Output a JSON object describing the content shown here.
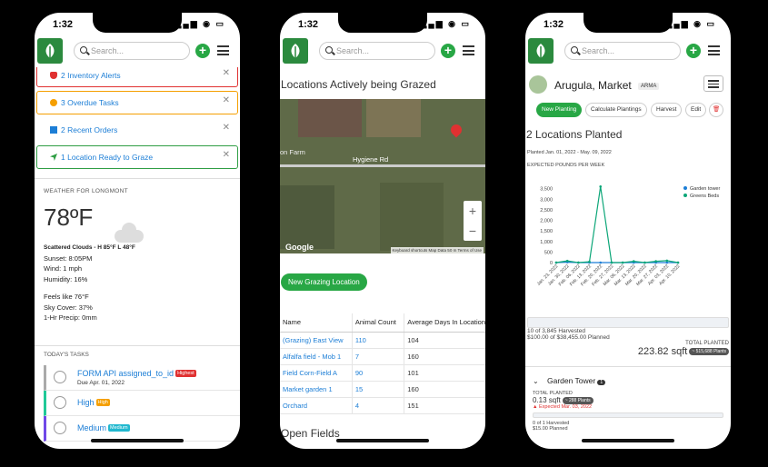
{
  "status": {
    "time": "1:32",
    "icons": "▂▄▆ ◉ ▭"
  },
  "search": {
    "placeholder": "Search..."
  },
  "phone1": {
    "alerts": [
      {
        "label": "2 Inventory Alerts"
      },
      {
        "label": "3 Overdue Tasks"
      },
      {
        "label": "2 Recent Orders"
      },
      {
        "label": "1 Location Ready to Graze"
      }
    ],
    "weather": {
      "label": "WEATHER FOR LONGMONT",
      "temp": "78ºF",
      "summary": "Scattered Clouds - H 85°F L 48°F",
      "sunset": "Sunset: 8:05PM",
      "wind": "Wind: 1 mph",
      "humidity": "Humidity: 16%",
      "feels": "Feels like 76°F",
      "sky": "Sky Cover: 37%",
      "precip": "1-Hr Precip: 0mm"
    },
    "tasks": {
      "label": "TODAY'S TASKS",
      "items": [
        {
          "title": "FORM API assigned_to_id",
          "tag": "Highest",
          "tag_color": "#e03131",
          "due": "Due Apr. 01, 2022",
          "border": "#aaa"
        },
        {
          "title": "High",
          "tag": "High",
          "tag_color": "#f59f00",
          "due": "",
          "border": "#20c997"
        },
        {
          "title": "Medium",
          "tag": "Medium",
          "tag_color": "#22b8cf",
          "due": "",
          "border": "#7048e8"
        }
      ]
    }
  },
  "phone2": {
    "title": "Locations Actively being Grazed",
    "map": {
      "road": "Hygiene Rd",
      "farm": "on Farm",
      "attribution": "Keyboard shortcuts  Map Data  50 m  Terms of Use",
      "logo": "Google"
    },
    "new_button": "New Grazing Location",
    "table": {
      "headers": [
        "Name",
        "Animal Count",
        "Average Days In Location"
      ],
      "rows": [
        [
          "(Grazing) East View",
          "110",
          "104"
        ],
        [
          "Alfalfa field - Mob 1",
          "7",
          "160"
        ],
        [
          "Field Corn-Field A",
          "90",
          "101"
        ],
        [
          "Market garden 1",
          "15",
          "160"
        ],
        [
          "Orchard",
          "4",
          "151"
        ]
      ]
    },
    "open_fields": "Open Fields"
  },
  "phone3": {
    "crop": {
      "name": "Arugula, Market",
      "badge": "ARMA"
    },
    "actions": [
      "New Planting",
      "Calculate Plantings",
      "Harvest",
      "Edit",
      "🗑"
    ],
    "locations_title": "2 Locations Planted",
    "planted_range": "Planted Jan. 01, 2022 - May. 09, 2022",
    "chart_label": "EXPECTED POUNDS PER WEEK",
    "harvested": "10 of 3,845 Harvested",
    "planned": "$100.00 of $38,455.00 Planned",
    "total_label": "TOTAL PLANTED",
    "total_value": "223.82 sqft",
    "total_chip": "~ 515,688 Plants",
    "garden": {
      "name": "Garden Tower",
      "count": "1",
      "total_label": "TOTAL PLANTED",
      "area": "0.13 sqft",
      "chip": "~ 288 Plants",
      "expected": "Expected Mar. 03, 2022",
      "harvested": "0 of 1 Harvested",
      "planned": "$15.00 Planned"
    }
  },
  "chart_data": {
    "type": "line",
    "title": "EXPECTED POUNDS PER WEEK",
    "categories": [
      "Jan. 23, 2022",
      "Jan. 30, 2022",
      "Feb. 06, 2022",
      "Feb. 13, 2022",
      "Feb. 20, 2022",
      "Feb. 27, 2022",
      "Mar. 06, 2022",
      "Mar. 13, 2022",
      "Mar. 20, 2022",
      "Mar. 27, 2022",
      "Apr. 03, 2022",
      "Apr. 10, 2022"
    ],
    "series": [
      {
        "name": "Garden tower",
        "color": "#1c7ed6",
        "values": [
          0,
          20,
          0,
          0,
          0,
          0,
          0,
          0,
          0,
          0,
          0,
          0
        ]
      },
      {
        "name": "Greens Beds",
        "color": "#0ca678",
        "values": [
          0,
          80,
          0,
          40,
          3600,
          0,
          0,
          60,
          0,
          60,
          90,
          0
        ]
      }
    ],
    "yticks": [
      "3,500",
      "3,000",
      "2,500",
      "2,000",
      "1,500",
      "1,000",
      "500",
      "0"
    ],
    "ylim": [
      0,
      3700
    ],
    "legend": "top-right"
  }
}
